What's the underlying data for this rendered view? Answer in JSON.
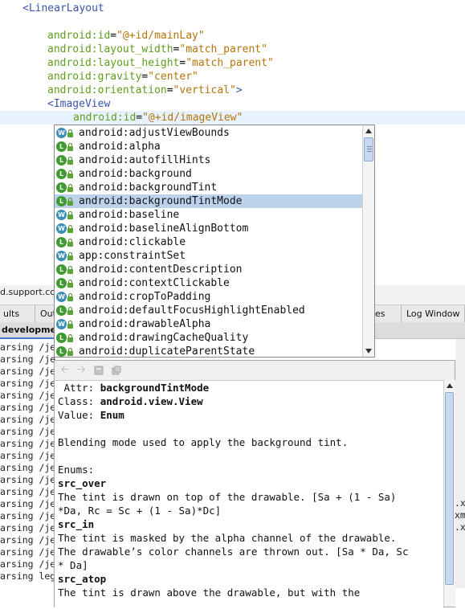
{
  "editor": {
    "lines": [
      {
        "tag_open": "<LinearLayout"
      },
      {
        "attr": "android:id",
        "value": "\"@+id/mainLay\""
      },
      {
        "attr": "android:layout_width",
        "value": "\"match_parent\""
      },
      {
        "attr": "android:layout_height",
        "value": "\"match_parent\""
      },
      {
        "attr": "android:gravity",
        "value": "\"center\""
      },
      {
        "attr": "android:orientation",
        "value": "\"vertical\"",
        "suffix": ">"
      },
      {
        "tag_open": "<ImageView"
      },
      {
        "attr": "android:id",
        "value": "\"@+id/imageView\""
      }
    ]
  },
  "completion": {
    "selected_index": 5,
    "items": [
      {
        "label": "android:adjustViewBounds",
        "kind": "W"
      },
      {
        "label": "android:alpha",
        "kind": "L"
      },
      {
        "label": "android:autofillHints",
        "kind": "L"
      },
      {
        "label": "android:background",
        "kind": "L"
      },
      {
        "label": "android:backgroundTint",
        "kind": "L"
      },
      {
        "label": "android:backgroundTintMode",
        "kind": "L"
      },
      {
        "label": "android:baseline",
        "kind": "W"
      },
      {
        "label": "android:baselineAlignBottom",
        "kind": "W"
      },
      {
        "label": "android:clickable",
        "kind": "L"
      },
      {
        "label": "app:constraintSet",
        "kind": "W"
      },
      {
        "label": "android:contentDescription",
        "kind": "L"
      },
      {
        "label": "android:contextClickable",
        "kind": "L"
      },
      {
        "label": "android:cropToPadding",
        "kind": "W"
      },
      {
        "label": "android:defaultFocusHighlightEnabled",
        "kind": "L"
      },
      {
        "label": "android:drawableAlpha",
        "kind": "W"
      },
      {
        "label": "android:drawingCacheQuality",
        "kind": "L"
      },
      {
        "label": "android:duplicateParentState",
        "kind": "L"
      }
    ]
  },
  "lower_panel": {
    "package_text": "d.support.co",
    "tabs": [
      {
        "label": "ults"
      },
      {
        "label": "Out"
      },
      {
        "label": "es"
      },
      {
        "label": "Log Window"
      }
    ],
    "sub_label": "developmen",
    "output_lines": [
      "arsing /je",
      "arsing /je",
      "arsing /je",
      "arsing /je",
      "arsing /je",
      "arsing /je",
      "arsing /je",
      "arsing /je",
      "arsing /je",
      "arsing /je",
      "arsing /je",
      "arsing /je",
      "arsing /je",
      "arsing /je",
      "arsing /je",
      "arsing /je",
      "arsing /je",
      "arsing /je",
      "arsing /je",
      "arsing leg"
    ],
    "right_fragments": [
      ".x",
      "xm",
      ".x"
    ]
  },
  "docs": {
    "lines": [
      {
        "segments": [
          {
            "t": " Attr: ",
            "b": false
          },
          {
            "t": "backgroundTintMode",
            "b": true
          }
        ]
      },
      {
        "segments": [
          {
            "t": "Class: ",
            "b": false
          },
          {
            "t": "android.view.View",
            "b": true
          }
        ]
      },
      {
        "segments": [
          {
            "t": "Value: ",
            "b": false
          },
          {
            "t": "Enum",
            "b": true
          }
        ]
      },
      {
        "segments": []
      },
      {
        "segments": [
          {
            "t": "Blending mode used to apply the background tint.",
            "b": false
          }
        ]
      },
      {
        "segments": []
      },
      {
        "segments": [
          {
            "t": "Enums:",
            "b": false
          }
        ]
      },
      {
        "segments": [
          {
            "t": "src_over",
            "b": true
          }
        ]
      },
      {
        "segments": [
          {
            "t": "The tint is drawn on top of the drawable. [Sa + (1 - Sa)",
            "b": false
          }
        ]
      },
      {
        "segments": [
          {
            "t": "*Da, Rc = Sc + (1 - Sa)*Dc]",
            "b": false
          }
        ]
      },
      {
        "segments": [
          {
            "t": "src_in",
            "b": true
          }
        ]
      },
      {
        "segments": [
          {
            "t": "The tint is masked by the alpha channel of the drawable.",
            "b": false
          }
        ]
      },
      {
        "segments": [
          {
            "t": "The drawable’s color channels are thrown out. [Sa * Da, Sc",
            "b": false
          }
        ]
      },
      {
        "segments": [
          {
            "t": "* Da]",
            "b": false
          }
        ]
      },
      {
        "segments": [
          {
            "t": "src_atop",
            "b": true
          }
        ]
      },
      {
        "segments": [
          {
            "t": "The tint is drawn above the drawable, but with the",
            "b": false
          }
        ]
      }
    ]
  },
  "icons": {
    "back": "left-arrow-icon",
    "forward": "right-arrow-icon",
    "open": "open-doc-icon",
    "external": "external-doc-icon"
  }
}
